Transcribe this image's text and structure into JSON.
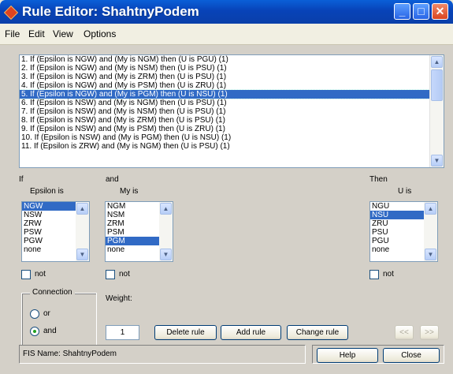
{
  "window": {
    "title": "Rule Editor: ShahtnyPodem"
  },
  "menu": [
    "File",
    "Edit",
    "View",
    "Options"
  ],
  "rules": [
    "1. If (Epsilon is NGW) and (My is NGM) then (U is PGU) (1)",
    "2. If (Epsilon is NGW) and (My is NSM) then (U is PSU) (1)",
    "3. If (Epsilon is NGW) and (My is ZRM) then (U is PSU) (1)",
    "4. If (Epsilon is NGW) and (My is PSM) then (U is ZRU) (1)",
    "5. If (Epsilon is NGW) and (My is PGM) then (U is NSU) (1)",
    "6. If (Epsilon is NSW) and (My is NGM) then (U is PSU) (1)",
    "7. If (Epsilon is NSW) and (My is NSM) then (U is PSU) (1)",
    "8. If (Epsilon is NSW) and (My is ZRM) then (U is PSU) (1)",
    "9. If (Epsilon is NSW) and (My is PSM) then (U is ZRU) (1)",
    "10. If (Epsilon is NSW) and (My is PGM) then (U is NSU) (1)",
    "11. If (Epsilon is ZRW) and (My is NGM) then (U is PSU) (1)"
  ],
  "selected_rule": 5,
  "labels": {
    "if": "If",
    "and": "and",
    "then": "Then",
    "epsilon": "Epsilon is",
    "my": "My is",
    "u": "U is",
    "not": "not",
    "connection": "Connection",
    "or": "or",
    "and_opt": "and",
    "weight": "Weight:"
  },
  "epsilon_items": [
    "NGW",
    "NSW",
    "ZRW",
    "PSW",
    "PGW",
    "none"
  ],
  "epsilon_selected": "NGW",
  "my_items": [
    "NGM",
    "NSM",
    "ZRM",
    "PSM",
    "PGM",
    "none"
  ],
  "my_selected": "PGM",
  "u_items": [
    "NGU",
    "NSU",
    "ZRU",
    "PSU",
    "PGU",
    "none"
  ],
  "u_selected": "NSU",
  "weight_value": "1",
  "buttons": {
    "delete": "Delete rule",
    "add": "Add rule",
    "change": "Change rule",
    "prev": "<<",
    "next": ">>",
    "help": "Help",
    "close": "Close"
  },
  "status": "FIS Name: ShahtnyPodem",
  "connection_selected": "and"
}
